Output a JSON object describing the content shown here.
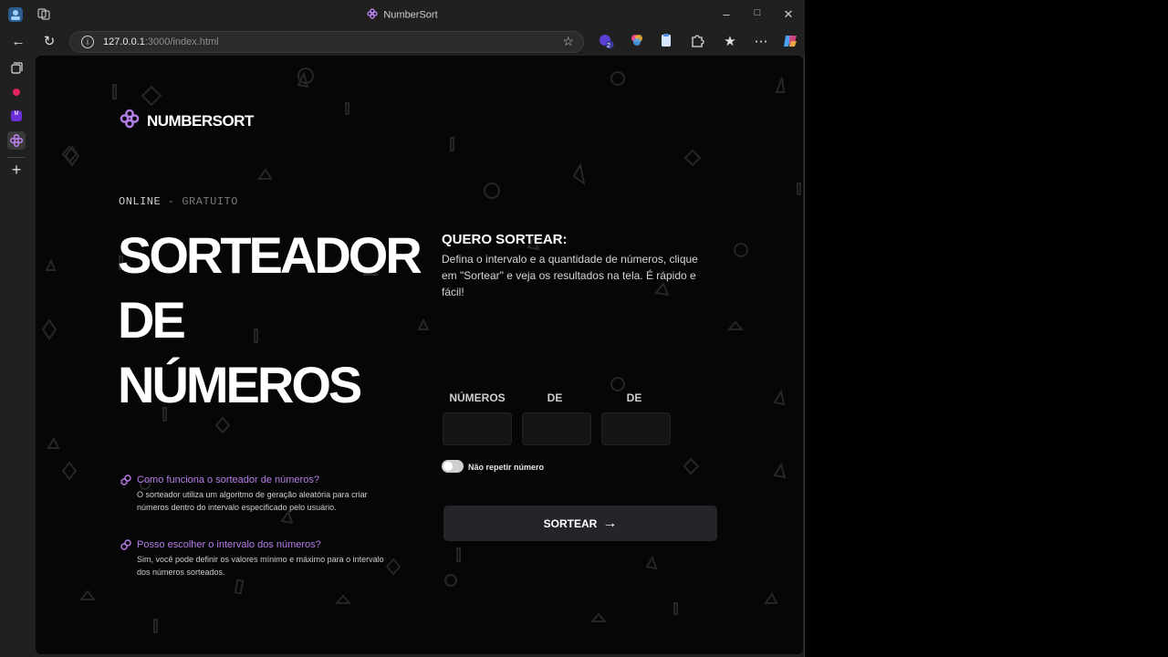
{
  "browser": {
    "window_title": "NumberSort",
    "url_host": "127.0.0.1",
    "url_path": ":3000/index.html",
    "extension_badge": "2",
    "sidebar_badge": "M"
  },
  "page": {
    "logo_text": "NUMBERSORT",
    "eyebrow_main": "ONLINE",
    "eyebrow_rest": " - GRATUITO",
    "hero_line1": "SORTEADOR",
    "hero_line2": "DE",
    "hero_line3": "NÚMEROS",
    "right_title": "QUERO SORTEAR:",
    "right_desc": "Defina o intervalo e a quantidade de números, clique em \"Sortear\" e veja os resultados na tela. É rápido e fácil!",
    "label_numeros": "NÚMEROS",
    "label_de1": "DE",
    "label_de2": "DE",
    "toggle_label": "Não repetir número",
    "button_label": "SORTEAR",
    "faq": [
      {
        "question": "Como funciona o sorteador de números?",
        "answer": "O sorteador utiliza um algoritmo de geração aleatória para criar números dentro do intervalo especificado pelo usuário."
      },
      {
        "question": "Posso escolher o intervalo dos números?",
        "answer": "Sim, você pode definir os valores mínimo e máximo para o intervalo dos números sorteados."
      }
    ]
  },
  "colors": {
    "accent": "#b67ee8",
    "background": "#060606",
    "button": "#24242b"
  }
}
